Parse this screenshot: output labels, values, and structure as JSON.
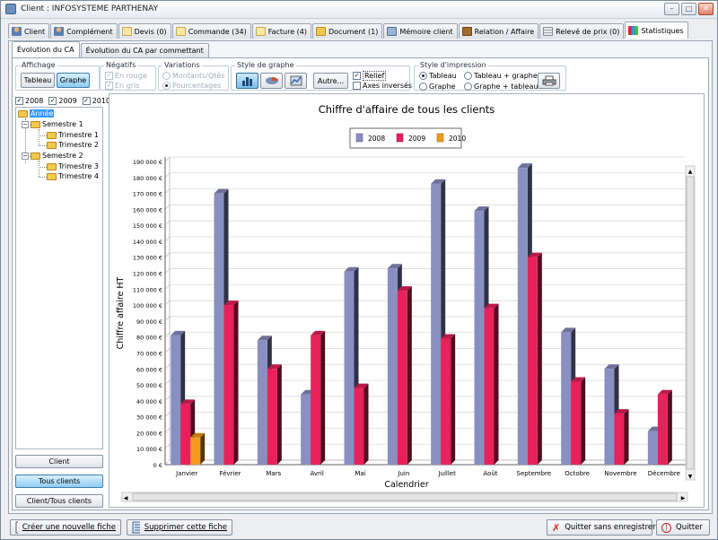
{
  "window": {
    "title": "Client : INFOSYSTEME PARTHENAY"
  },
  "tabs": [
    {
      "label": "Client",
      "icon": "user-icon"
    },
    {
      "label": "Complément",
      "icon": "user-icon"
    },
    {
      "label": "Devis (0)",
      "icon": "document-icon"
    },
    {
      "label": "Commande (34)",
      "icon": "document-icon"
    },
    {
      "label": "Facture (4)",
      "icon": "document-icon"
    },
    {
      "label": "Document (1)",
      "icon": "folder-icon"
    },
    {
      "label": "Mémoire client",
      "icon": "memo-icon"
    },
    {
      "label": "Relation / Affaire",
      "icon": "briefcase-icon"
    },
    {
      "label": "Relevé de prix (0)",
      "icon": "grid-icon"
    },
    {
      "label": "Statistiques",
      "icon": "chart-icon"
    }
  ],
  "subtabs": [
    "Évolution du CA",
    "Évolution du CA par commettant"
  ],
  "toolbar": {
    "affichage": {
      "label": "Affichage",
      "tableau": "Tableau",
      "graphe": "Graphe"
    },
    "negatifs": {
      "label": "Négatifs",
      "en_rouge": "En rouge",
      "en_gris": "En gris"
    },
    "variations": {
      "label": "Variations",
      "montants": "Montants/Qtés",
      "pourcentages": "Pourcentages"
    },
    "style_graphe": {
      "label": "Style de graphe",
      "autre": "Autre...",
      "relief": "Relief",
      "axes_inverses": "Axes inversés"
    },
    "style_impression": {
      "label": "Style d'impression",
      "tableau": "Tableau",
      "tableau_graphe": "Tableau + graphe",
      "graphe": "Graphe",
      "graphe_tableau": "Graphe + tableau"
    }
  },
  "years": [
    "2008",
    "2009",
    "2010"
  ],
  "tree": {
    "root": "Année",
    "s1": "Semestre 1",
    "t1": "Trimestre 1",
    "t2": "Trimestre 2",
    "s2": "Semestre 2",
    "t3": "Trimestre 3",
    "t4": "Trimestre 4"
  },
  "left_buttons": {
    "client": "Client",
    "tous_clients": "Tous clients",
    "client_tous": "Client/Tous clients"
  },
  "status": {
    "create": "Créer une nouvelle fiche",
    "delete": "Supprimer cette fiche",
    "quit_nosave": "Quitter sans enregistrer",
    "quit": "Quitter"
  },
  "chart_data": {
    "type": "bar",
    "title": "Chiffre d'affaire de tous les clients",
    "xlabel": "Calendrier",
    "ylabel": "Chiffre affaire HT",
    "ylim": [
      0,
      190000
    ],
    "categories": [
      "Janvier",
      "Février",
      "Mars",
      "Avril",
      "Mai",
      "Juin",
      "Juillet",
      "Août",
      "Septembre",
      "Octobre",
      "Novembre",
      "Décembre"
    ],
    "series": [
      {
        "name": "2008",
        "color": "#8a8fc2",
        "values": [
          81000,
          170000,
          78000,
          44000,
          121000,
          123000,
          176000,
          159000,
          186000,
          83000,
          60000,
          21000
        ]
      },
      {
        "name": "2009",
        "color": "#e8215a",
        "values": [
          38000,
          100000,
          60000,
          81000,
          48000,
          109000,
          79000,
          98000,
          130000,
          52000,
          32000,
          44000
        ]
      },
      {
        "name": "2010",
        "color": "#f39a1e",
        "values": [
          17000,
          0,
          0,
          0,
          0,
          0,
          0,
          0,
          0,
          0,
          0,
          0
        ]
      }
    ],
    "yticks": [
      "0 €",
      "10 000 €",
      "20 000 €",
      "30 000 €",
      "40 000 €",
      "50 000 €",
      "60 000 €",
      "70 000 €",
      "80 000 €",
      "90 000 €",
      "100 000 €",
      "110 000 €",
      "120 000 €",
      "130 000 €",
      "140 000 €",
      "150 000 €",
      "160 000 €",
      "170 000 €",
      "180 000 €",
      "190 000 €"
    ],
    "legend_position": "top-center",
    "grid": true
  }
}
